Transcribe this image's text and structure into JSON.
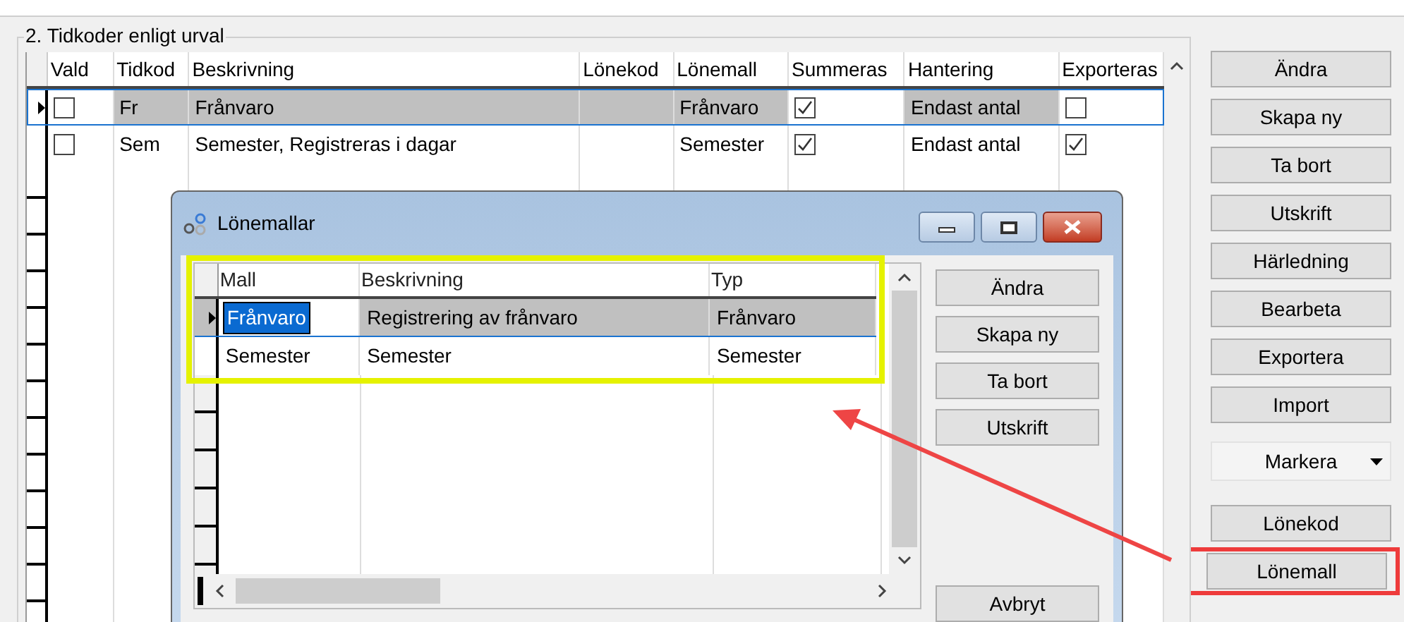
{
  "group": {
    "title": "2. Tidkoder enligt urval"
  },
  "table": {
    "columns": [
      "Vald",
      "Tidkod",
      "Beskrivning",
      "Lönekod",
      "Lönemall",
      "Summeras",
      "Hantering",
      "Exporteras"
    ],
    "rows": [
      {
        "selected": true,
        "vald": false,
        "tidkod": "Fr",
        "beskrivning": "Frånvaro",
        "lonemall": "Frånvaro",
        "summeras": true,
        "hantering": "Endast antal",
        "exporteras": false
      },
      {
        "selected": false,
        "vald": false,
        "tidkod": "Sem",
        "beskrivning": "Semester, Registreras i dagar",
        "lonemall": "Semester",
        "summeras": true,
        "hantering": "Endast antal",
        "exporteras": true
      }
    ]
  },
  "buttons": [
    {
      "label": "Ändra",
      "kind": "button",
      "highlighted": false
    },
    {
      "label": "Skapa ny",
      "kind": "button",
      "highlighted": false
    },
    {
      "label": "Ta bort",
      "kind": "button",
      "highlighted": false
    },
    {
      "label": "Utskrift",
      "kind": "button",
      "highlighted": false
    },
    {
      "label": "Härledning",
      "kind": "button",
      "highlighted": false
    },
    {
      "label": "Bearbeta",
      "kind": "button",
      "highlighted": false
    },
    {
      "label": "Exportera",
      "kind": "button",
      "highlighted": false
    },
    {
      "label": "Import",
      "kind": "button",
      "highlighted": false
    },
    {
      "label": "Markera",
      "kind": "dropdown",
      "highlighted": false
    },
    {
      "label": "Lönekod",
      "kind": "button",
      "highlighted": false
    },
    {
      "label": "Lönemall",
      "kind": "button",
      "highlighted": true
    }
  ],
  "dialog": {
    "title": "Lönemallar",
    "grid_highlighted": true,
    "columns": [
      "Mall",
      "Beskrivning",
      "Typ"
    ],
    "rows": [
      {
        "selected": true,
        "mall": "Frånvaro",
        "beskrivning": "Registrering av frånvaro",
        "typ": "Frånvaro"
      },
      {
        "selected": false,
        "mall": "Semester",
        "beskrivning": "Semester",
        "typ": "Semester"
      }
    ],
    "buttons": [
      "Ändra",
      "Skapa ny",
      "Ta bort",
      "Utskrift"
    ],
    "cancel_button": "Avbryt"
  }
}
